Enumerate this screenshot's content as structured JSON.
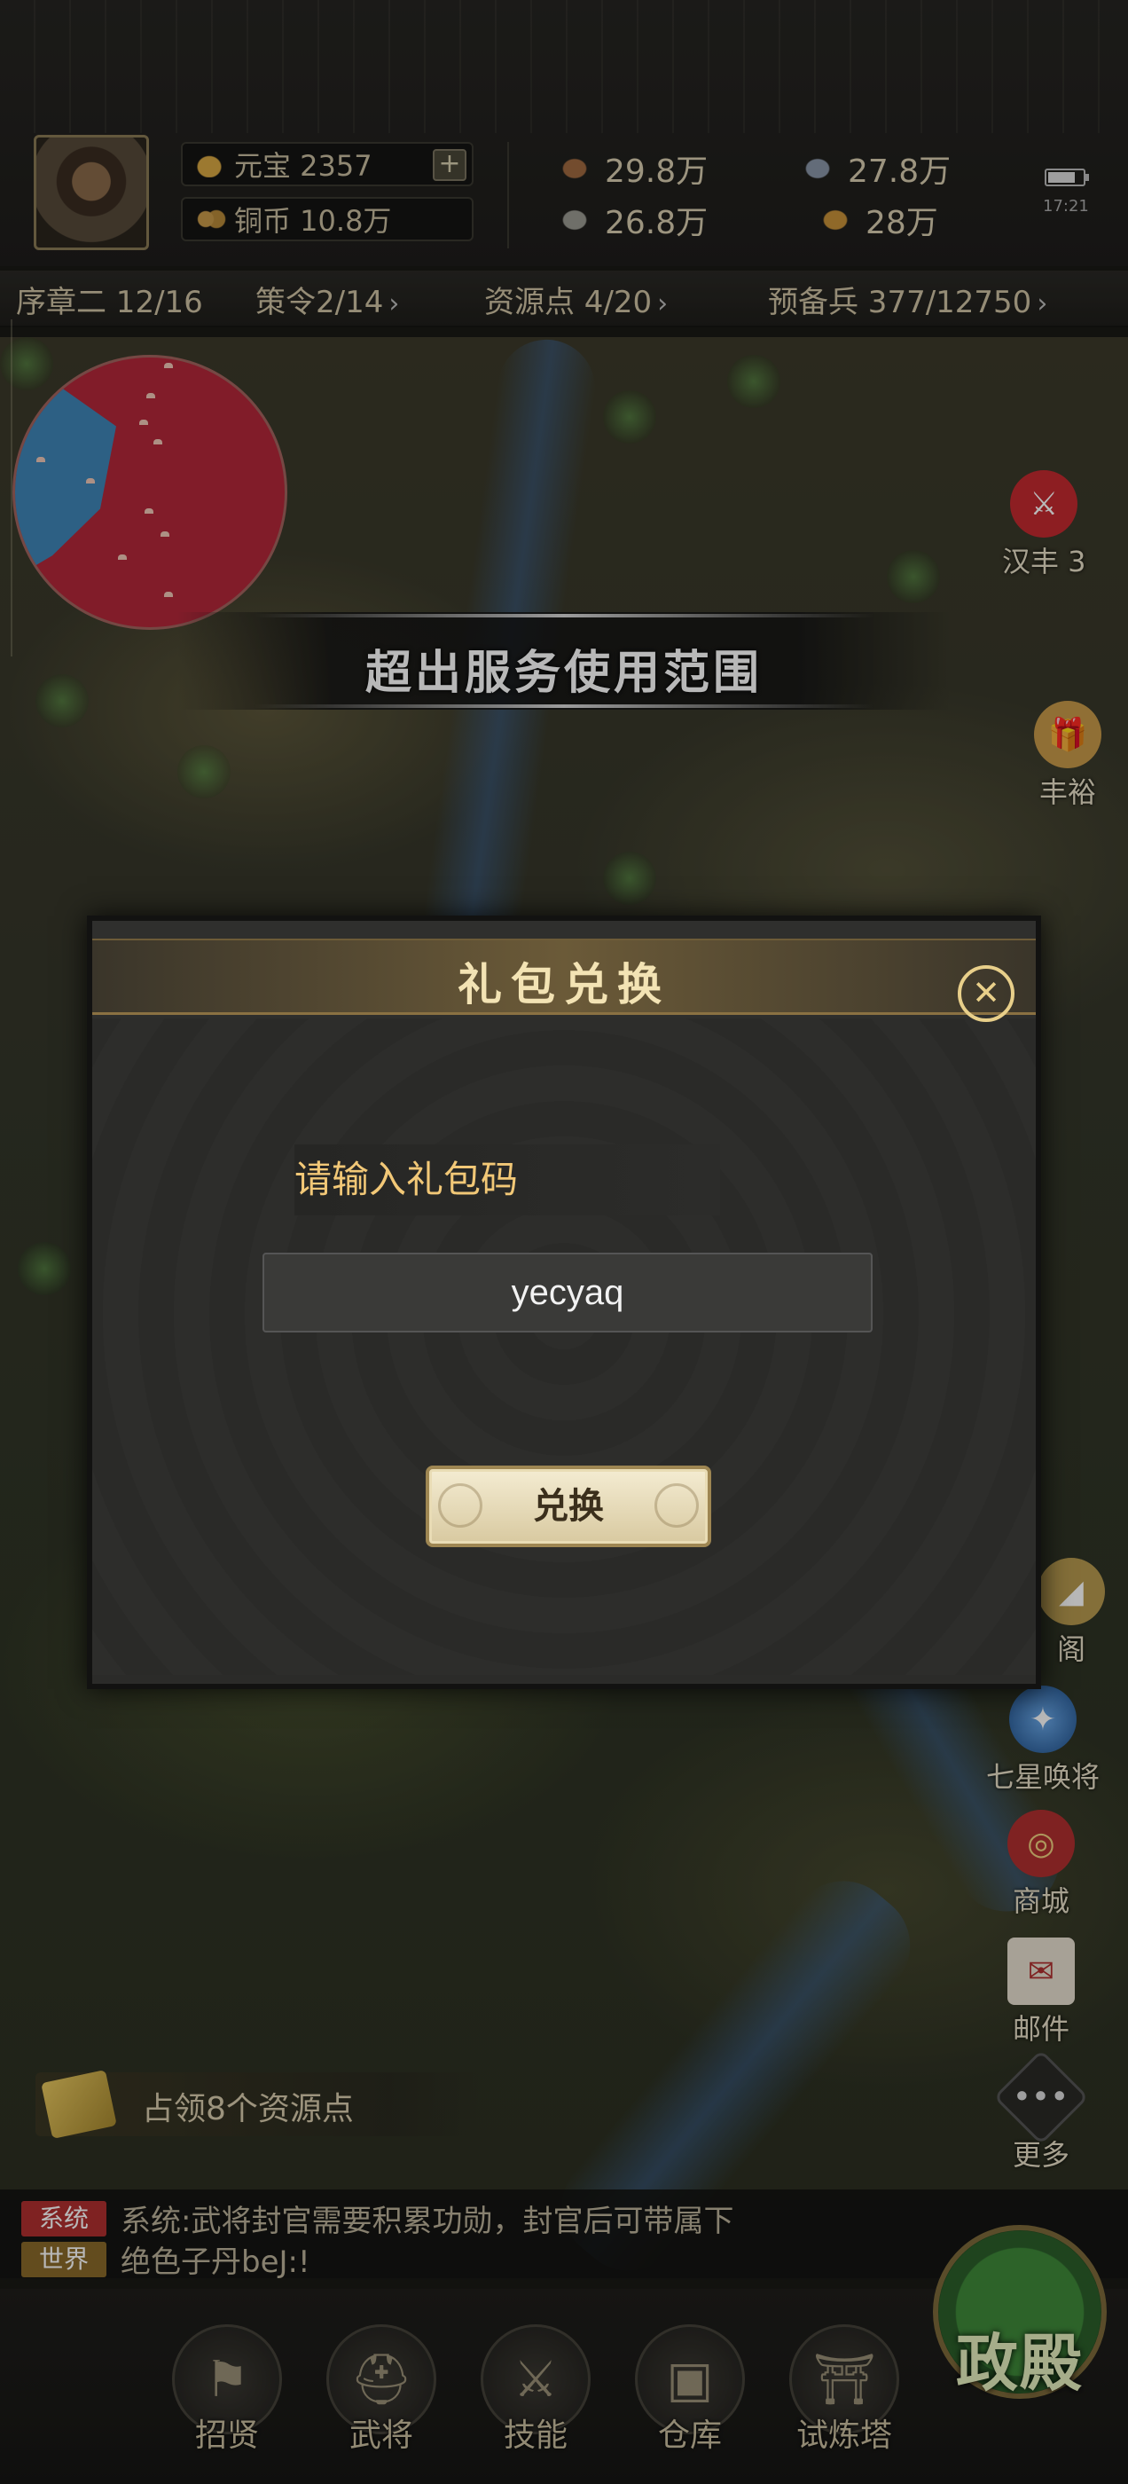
{
  "top": {
    "currency": {
      "yuanbao": "元宝 2357",
      "tongbi": "铜币 10.8万"
    },
    "resources": {
      "wood": "29.8万",
      "iron": "27.8万",
      "stone": "26.8万",
      "grain": "28万"
    },
    "battery_level": 0.8,
    "time": "17:21"
  },
  "subbar": {
    "chapter": "序章二 12/16",
    "orders": "策令2/14",
    "resource_points": "资源点 4/20",
    "reserve": "预备兵 377/12750",
    "chevron": "›"
  },
  "toast": {
    "message": "超出服务使用范围"
  },
  "side_icons": {
    "hanfeng": "汉丰  3",
    "fengyu": "丰裕",
    "chuangge": "阁",
    "qixing": "七星唤将",
    "shop": "商城",
    "mail": "邮件",
    "more": "更多"
  },
  "dialog": {
    "title": "礼包兑换",
    "close_glyph": "✕",
    "prompt": "请输入礼包码",
    "code_value": "yecyaq",
    "redeem_label": "兑换"
  },
  "objective": {
    "text": "占领8个资源点"
  },
  "chat": {
    "rows": [
      {
        "tag": "系统",
        "tag_color": "#b03030",
        "text": "系统:武将封官需要积累功勋，封官后可带属下"
      },
      {
        "tag": "世界",
        "tag_color": "#8a6a2a",
        "text": "绝色子丹beJ:!"
      }
    ]
  },
  "bottom_nav": {
    "recruit": "招贤",
    "generals": "武将",
    "skills": "技能",
    "warehouse": "仓库",
    "tower": "试炼塔",
    "palace": "政殿"
  },
  "colors": {
    "accent_gold": "#f2c877",
    "palace_green": "#3f8a3a",
    "minimap_red": "#b3283a",
    "minimap_blue": "#3f86b8"
  }
}
